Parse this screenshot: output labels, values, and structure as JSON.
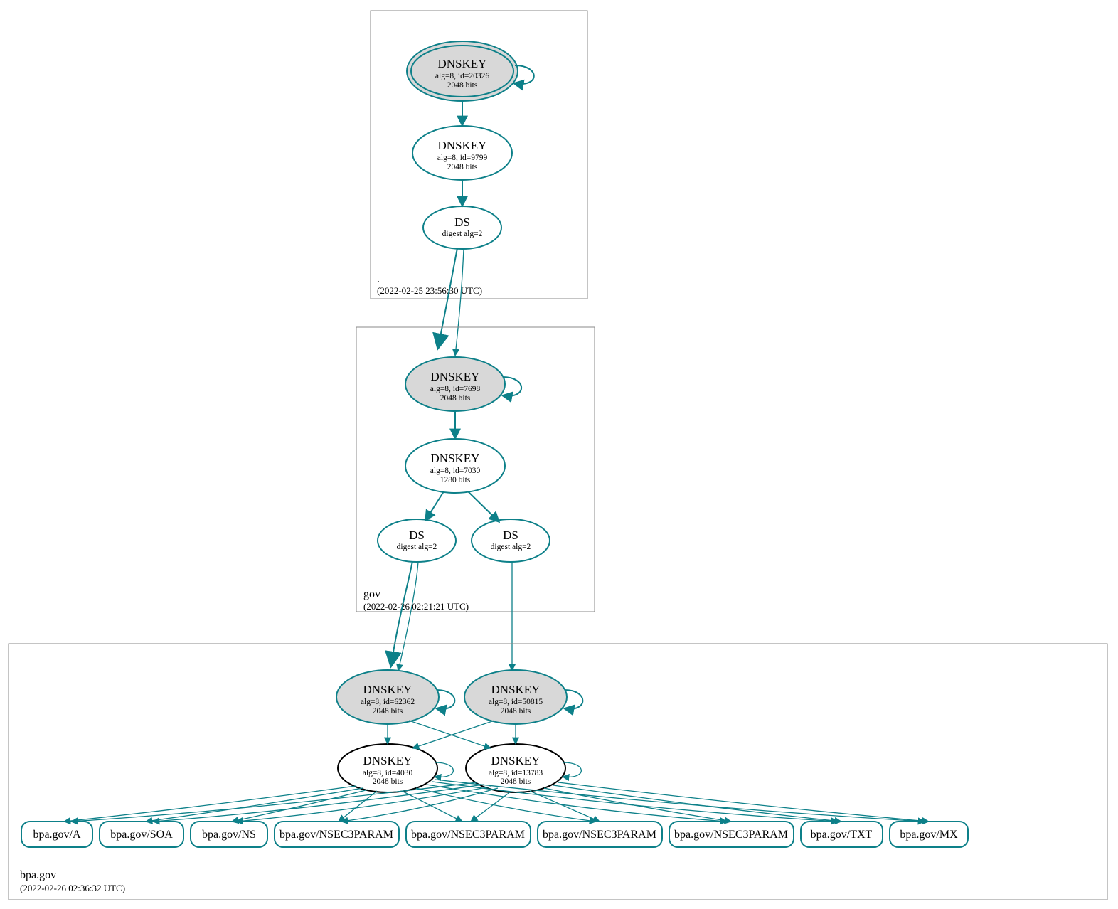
{
  "zones": {
    "root": {
      "label": ".",
      "timestamp": "(2022-02-25 23:56:30 UTC)",
      "nodes": {
        "ksk": {
          "title": "DNSKEY",
          "line1": "alg=8, id=20326",
          "line2": "2048 bits"
        },
        "zsk": {
          "title": "DNSKEY",
          "line1": "alg=8, id=9799",
          "line2": "2048 bits"
        },
        "ds": {
          "title": "DS",
          "line1": "digest alg=2"
        }
      }
    },
    "gov": {
      "label": "gov",
      "timestamp": "(2022-02-26 02:21:21 UTC)",
      "nodes": {
        "ksk": {
          "title": "DNSKEY",
          "line1": "alg=8, id=7698",
          "line2": "2048 bits"
        },
        "zsk": {
          "title": "DNSKEY",
          "line1": "alg=8, id=7030",
          "line2": "1280 bits"
        },
        "ds1": {
          "title": "DS",
          "line1": "digest alg=2"
        },
        "ds2": {
          "title": "DS",
          "line1": "digest alg=2"
        }
      }
    },
    "bpagov": {
      "label": "bpa.gov",
      "timestamp": "(2022-02-26 02:36:32 UTC)",
      "nodes": {
        "ksk1": {
          "title": "DNSKEY",
          "line1": "alg=8, id=62362",
          "line2": "2048 bits"
        },
        "ksk2": {
          "title": "DNSKEY",
          "line1": "alg=8, id=50815",
          "line2": "2048 bits"
        },
        "zsk1": {
          "title": "DNSKEY",
          "line1": "alg=8, id=4030",
          "line2": "2048 bits"
        },
        "zsk2": {
          "title": "DNSKEY",
          "line1": "alg=8, id=13783",
          "line2": "2048 bits"
        }
      },
      "rrsets": [
        "bpa.gov/A",
        "bpa.gov/SOA",
        "bpa.gov/NS",
        "bpa.gov/NSEC3PARAM",
        "bpa.gov/NSEC3PARAM",
        "bpa.gov/NSEC3PARAM",
        "bpa.gov/NSEC3PARAM",
        "bpa.gov/TXT",
        "bpa.gov/MX"
      ]
    }
  },
  "colors": {
    "teal": "#0d8089",
    "gray_fill": "#d8d8d8"
  }
}
